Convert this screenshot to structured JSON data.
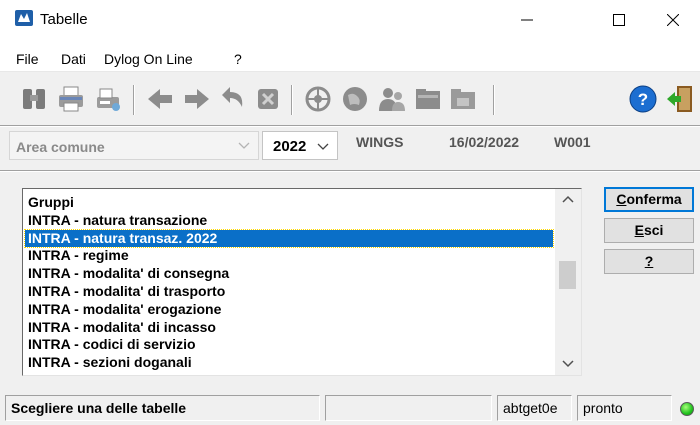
{
  "window": {
    "title": "Tabelle"
  },
  "menu": [
    "File",
    "Dati",
    "Dylog On Line",
    "?"
  ],
  "toolbar": {
    "icons": [
      "binoculars-icon",
      "printer-icon",
      "print-preview-icon",
      "arrow-left-icon",
      "arrow-right-icon",
      "undo-icon",
      "erase-icon",
      "wheel-icon",
      "globe-icon",
      "users-icon",
      "folder-icon",
      "folder-gray-icon",
      "help-icon",
      "exit-door-icon"
    ]
  },
  "context": {
    "area_value": "Area comune",
    "year_value": "2022",
    "company": "WINGS",
    "date": "16/02/2022",
    "code": "W001"
  },
  "list": {
    "items": [
      "Gruppi",
      "INTRA - natura transazione",
      "INTRA - natura transaz. 2022",
      "INTRA - regime",
      "INTRA - modalita' di consegna",
      "INTRA - modalita' di trasporto",
      "INTRA - modalita' erogazione",
      "INTRA - modalita' di incasso",
      "INTRA - codici di servizio",
      "INTRA - sezioni doganali"
    ],
    "selected_index": 2
  },
  "buttons": {
    "confirm": {
      "key": "C",
      "rest": "onferma"
    },
    "exit": {
      "key": "E",
      "rest": "sci"
    },
    "help": {
      "key": "?",
      "rest": ""
    }
  },
  "status": {
    "message": "Scegliere una delle tabelle",
    "empty": "",
    "program": "abtget0e",
    "state": "pronto"
  },
  "colors": {
    "selection": "#0a6fc8",
    "led": "#21c21e",
    "accent": "#0078d7"
  }
}
